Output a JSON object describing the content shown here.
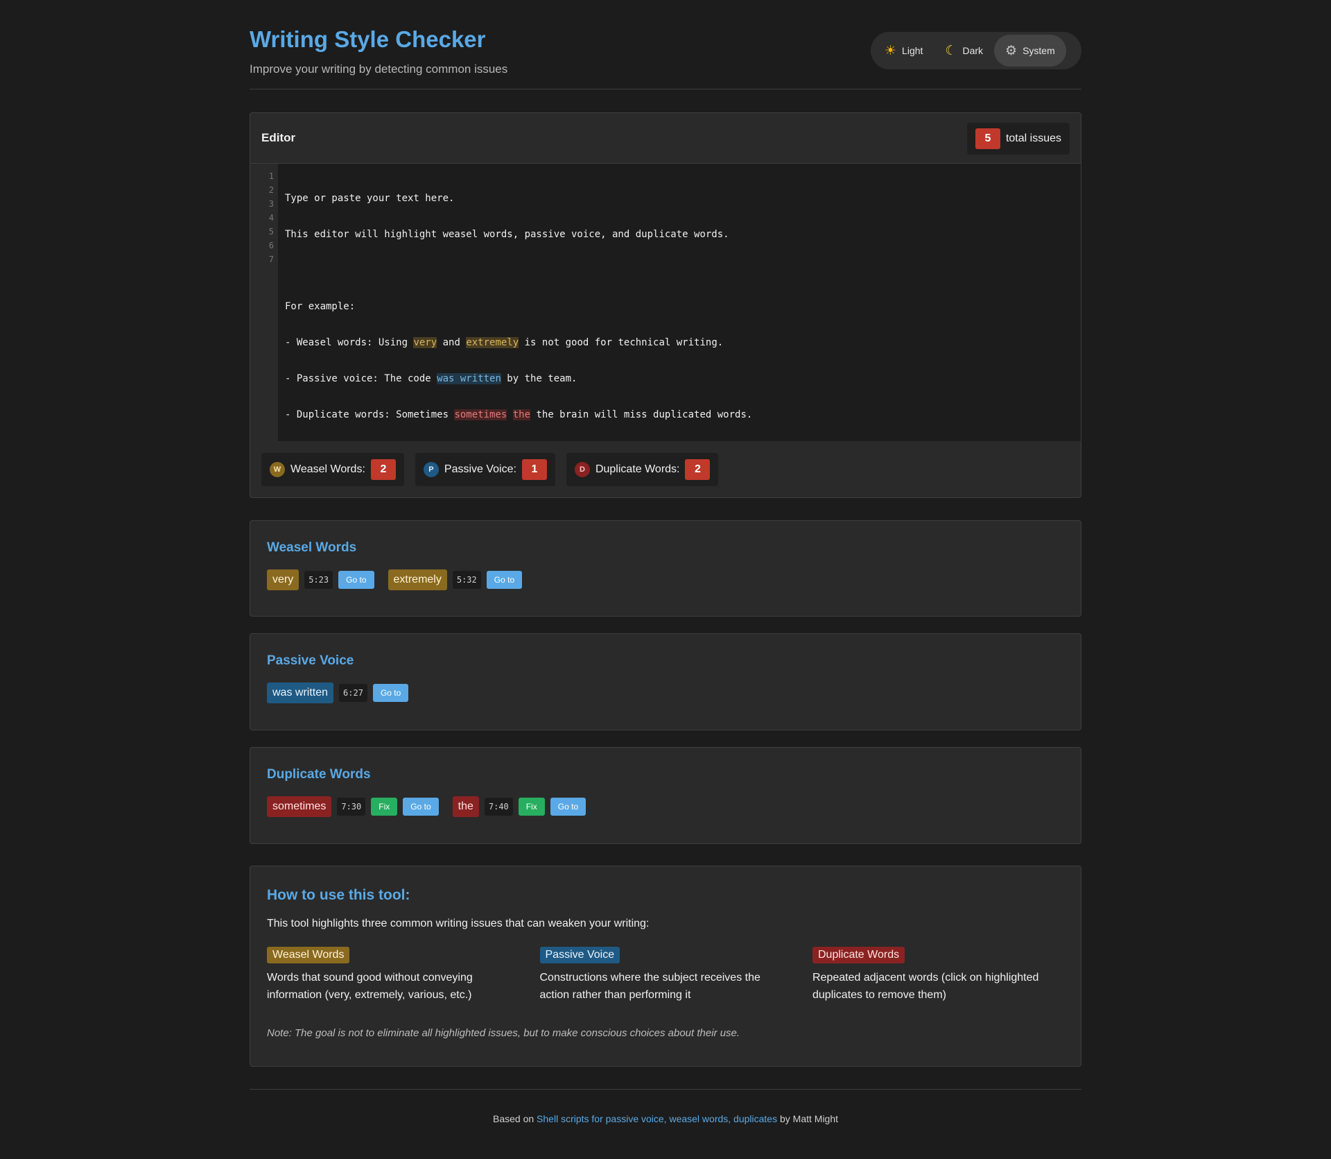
{
  "header": {
    "title": "Writing Style Checker",
    "subtitle": "Improve your writing by detecting common issues"
  },
  "theme": {
    "options": [
      {
        "label": "Light",
        "icon": "sun-icon"
      },
      {
        "label": "Dark",
        "icon": "moon-icon"
      },
      {
        "label": "System",
        "icon": "gear-icon"
      }
    ],
    "selected": "System"
  },
  "editor": {
    "title": "Editor",
    "total_count": "5",
    "total_label": "total issues",
    "line_numbers": [
      "1",
      "2",
      "3",
      "4",
      "5",
      "6",
      "7"
    ],
    "lines": {
      "l1": "Type or paste your text here.",
      "l2": "This editor will highlight weasel words, passive voice, and duplicate words.",
      "l3": "",
      "l4": "For example:",
      "l5": {
        "a": "- Weasel words: Using ",
        "h1": "very",
        "b": " and ",
        "h2": "extremely",
        "c": " is not good for technical writing."
      },
      "l6": {
        "a": "- Passive voice: The code ",
        "h1": "was written",
        "b": " by the team."
      },
      "l7": {
        "a": "- Duplicate words: Sometimes ",
        "h1": "sometimes",
        "b": " ",
        "h2": "the",
        "c": " the brain will miss duplicated words."
      }
    },
    "stats": {
      "weasel": {
        "icon_letter": "W",
        "label": "Weasel Words:",
        "count": "2"
      },
      "passive": {
        "icon_letter": "P",
        "label": "Passive Voice:",
        "count": "1"
      },
      "duplicate": {
        "icon_letter": "D",
        "label": "Duplicate Words:",
        "count": "2"
      }
    }
  },
  "weasel_section": {
    "title": "Weasel Words",
    "items": [
      {
        "word": "very",
        "pos": "5:23",
        "goto": "Go to"
      },
      {
        "word": "extremely",
        "pos": "5:32",
        "goto": "Go to"
      }
    ]
  },
  "passive_section": {
    "title": "Passive Voice",
    "items": [
      {
        "word": "was written",
        "pos": "6:27",
        "goto": "Go to"
      }
    ]
  },
  "duplicate_section": {
    "title": "Duplicate Words",
    "items": [
      {
        "word": "sometimes",
        "pos": "7:30",
        "fix": "Fix",
        "goto": "Go to"
      },
      {
        "word": "the",
        "pos": "7:40",
        "fix": "Fix",
        "goto": "Go to"
      }
    ]
  },
  "howto": {
    "title": "How to use this tool:",
    "intro": "This tool highlights three common writing issues that can weaken your writing:",
    "cols": [
      {
        "tag": "Weasel Words",
        "desc": "Words that sound good without conveying information (very, extremely, various, etc.)"
      },
      {
        "tag": "Passive Voice",
        "desc": "Constructions where the subject receives the action rather than performing it"
      },
      {
        "tag": "Duplicate Words",
        "desc": "Repeated adjacent words (click on highlighted duplicates to remove them)"
      }
    ],
    "note": "Note: The goal is not to eliminate all highlighted issues, but to make conscious choices about their use."
  },
  "footer": {
    "prefix": "Based on ",
    "link": "Shell scripts for passive voice, weasel words, duplicates",
    "suffix": " by Matt Might"
  },
  "colors": {
    "accent": "#5aa9e6",
    "weasel": "#8a6a1f",
    "passive": "#1f5a85",
    "duplicate": "#8a2222",
    "count_badge": "#c0392b",
    "fix_button": "#27ae60"
  }
}
